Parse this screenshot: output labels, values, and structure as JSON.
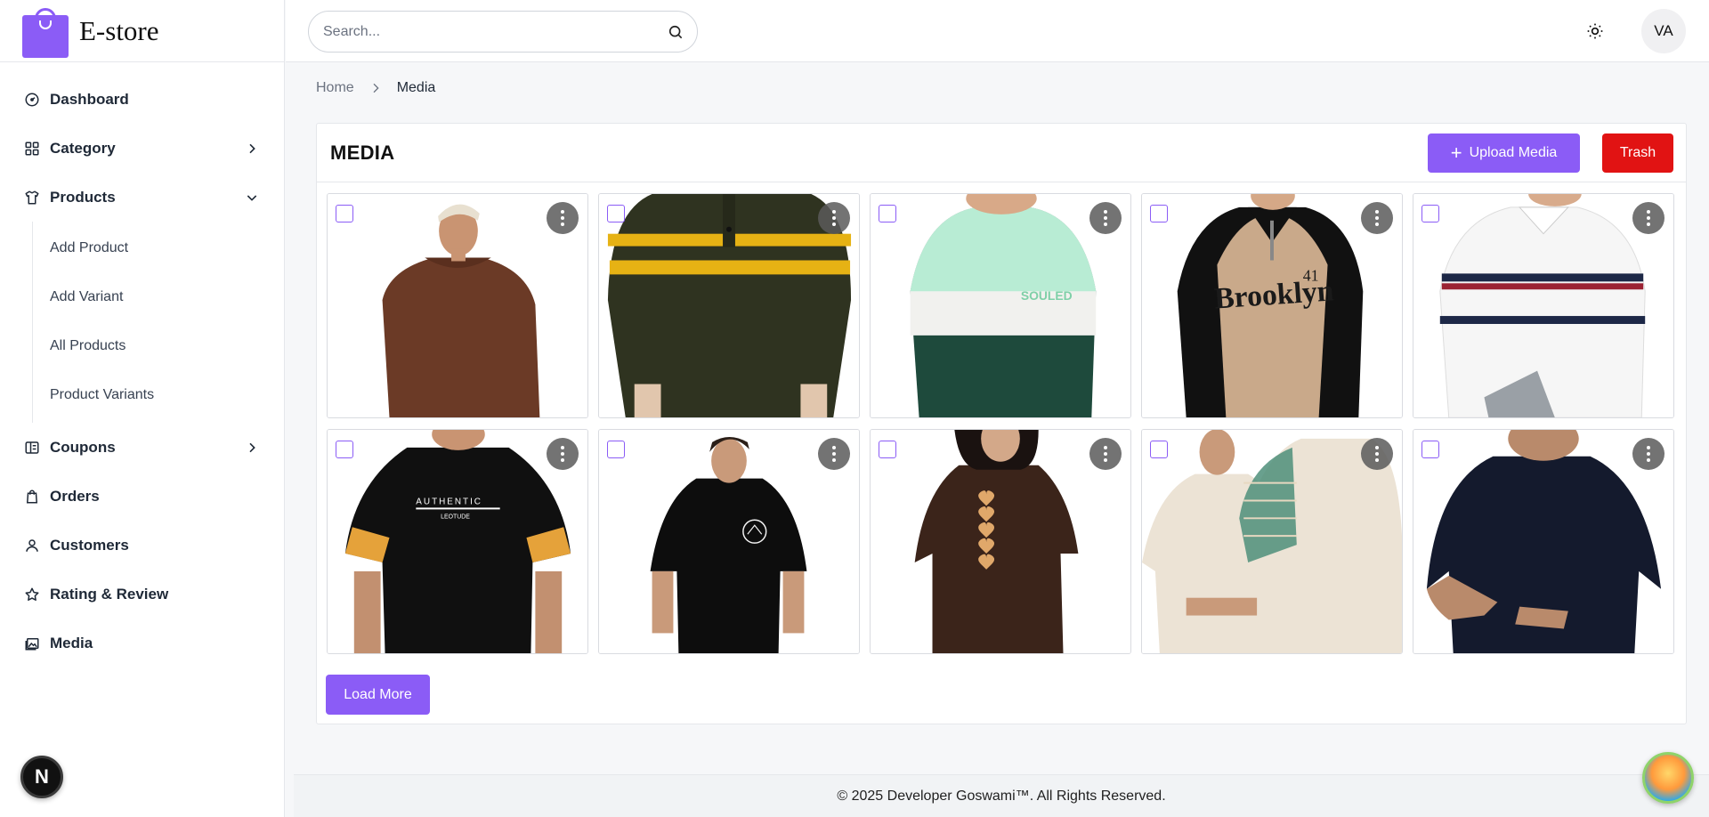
{
  "brand": {
    "name": "E-store"
  },
  "search": {
    "placeholder": "Search..."
  },
  "user": {
    "initials": "VA"
  },
  "sidebar": {
    "items": [
      {
        "label": "Dashboard",
        "icon": "gauge-icon"
      },
      {
        "label": "Category",
        "icon": "grid-icon"
      },
      {
        "label": "Products",
        "icon": "shirt-icon"
      },
      {
        "label": "Coupons",
        "icon": "ticket-icon"
      },
      {
        "label": "Orders",
        "icon": "bag-icon"
      },
      {
        "label": "Customers",
        "icon": "user-icon"
      },
      {
        "label": "Rating & Review",
        "icon": "star-icon"
      },
      {
        "label": "Media",
        "icon": "image-icon"
      }
    ],
    "product_subitems": [
      {
        "label": "Add Product"
      },
      {
        "label": "Add Variant"
      },
      {
        "label": "All Products"
      },
      {
        "label": "Product Variants"
      }
    ]
  },
  "next_badge": "N",
  "breadcrumb": {
    "home": "Home",
    "current": "Media"
  },
  "media": {
    "title": "MEDIA",
    "upload_label": "Upload Media",
    "trash_label": "Trash",
    "load_more_label": "Load More",
    "items": [
      {
        "desc": "brown sweatshirt",
        "main": "#6b3a26",
        "accent": "#6b3a26"
      },
      {
        "desc": "olive polo yellow stripes",
        "main": "#2f3320",
        "accent": "#e6b214"
      },
      {
        "desc": "mint white green sweatshirt",
        "main": "#1e4a3c",
        "accent": "#b8ecd4"
      },
      {
        "desc": "brooklyn raglan",
        "main": "#c9a98a",
        "accent": "#111111"
      },
      {
        "desc": "white striped polo",
        "main": "#f4f4f4",
        "accent": "#1d2847"
      },
      {
        "desc": "black authentic tee",
        "main": "#101010",
        "accent": "#e5a23a"
      },
      {
        "desc": "black graphic tee",
        "main": "#0d0d0d",
        "accent": "#f2f2f2"
      },
      {
        "desc": "brown hearts tee",
        "main": "#3b241a",
        "accent": "#e0a86a"
      },
      {
        "desc": "cream tee pattern",
        "main": "#ece3d5",
        "accent": "#4f8f7a"
      },
      {
        "desc": "navy oversized tee",
        "main": "#141a2d",
        "accent": "#141a2d"
      }
    ]
  },
  "footer": {
    "text": "© 2025 Developer Goswami™. All Rights Reserved."
  },
  "colors": {
    "accent": "#8b5cf6",
    "danger": "#e11313"
  }
}
